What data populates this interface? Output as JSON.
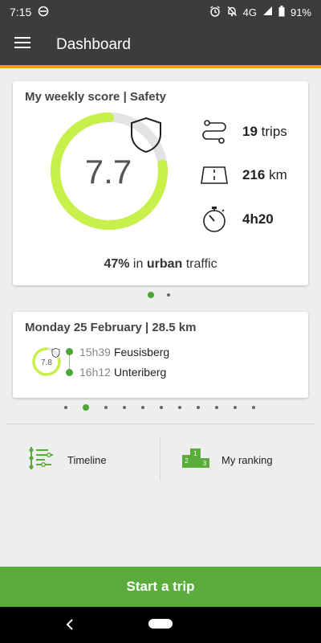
{
  "statusbar": {
    "time": "7:15",
    "network": "4G",
    "battery": "91%"
  },
  "appbar": {
    "title": "Dashboard"
  },
  "score_card": {
    "title": "My weekly score | Safety",
    "score": "7.7",
    "score_fraction": 0.77,
    "stats": [
      {
        "icon": "route-icon",
        "value": "19",
        "unit": "trips"
      },
      {
        "icon": "road-icon",
        "value": "216",
        "unit": "km"
      },
      {
        "icon": "stopwatch-icon",
        "value": "4h20",
        "unit": ""
      }
    ],
    "urban": {
      "percent": "47%",
      "in": "in",
      "urban": "urban",
      "traffic": "traffic"
    }
  },
  "score_pager": {
    "count": 2,
    "active": 0
  },
  "trip_card": {
    "title": "Monday 25 February | 28.5 km",
    "score": "7.8",
    "score_fraction": 0.78,
    "start": {
      "time": "15h39",
      "place": "Feusisberg"
    },
    "end": {
      "time": "16h12",
      "place": "Unteriberg"
    }
  },
  "trip_pager": {
    "count": 11,
    "active": 1
  },
  "shortcuts": {
    "timeline": {
      "label": "Timeline",
      "icon": "timeline-icon"
    },
    "ranking": {
      "label": "My ranking",
      "icon": "podium-icon"
    }
  },
  "start_button": {
    "label": "Start a trip"
  },
  "colors": {
    "accent": "#5aad3a",
    "gauge": "#c8f04a",
    "appbar": "#3c3c3c",
    "appbar_accent": "#f0a10b"
  }
}
